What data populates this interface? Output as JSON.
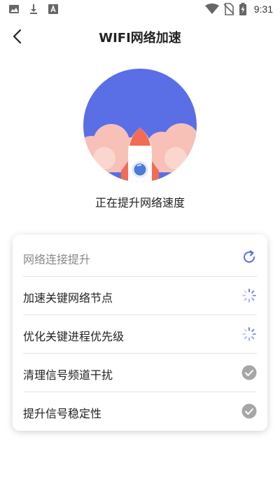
{
  "status_bar": {
    "time": "9:31",
    "left_icons": [
      "image-icon",
      "download-icon",
      "font-icon"
    ],
    "right_icons": [
      "wifi-icon",
      "no-sim-icon",
      "battery-charging-icon"
    ]
  },
  "header": {
    "title": "WIFI网络加速",
    "back_icon": "back-arrow-icon"
  },
  "hero": {
    "status_text": "正在提升网络速度",
    "colors": {
      "circle": "#5A6EE6",
      "cloud": "#F7C1B8",
      "rocket_nose": "#F26B54",
      "rocket_body": "#FFFFFF",
      "window": "#4A7BD8"
    }
  },
  "tasks": [
    {
      "label": "网络连接提升",
      "state": "refresh",
      "icon": "refresh-icon"
    },
    {
      "label": "加速关键网络节点",
      "state": "loading",
      "icon": "loading-spinner-icon"
    },
    {
      "label": "优化关键进程优先级",
      "state": "loading",
      "icon": "loading-spinner-icon"
    },
    {
      "label": "清理信号频道干扰",
      "state": "done",
      "icon": "check-circle-icon"
    },
    {
      "label": "提升信号稳定性",
      "state": "done",
      "icon": "check-circle-icon"
    }
  ],
  "colors": {
    "accent": "#5A6EE6",
    "done_gray": "#A6A6A6",
    "muted_text": "#888888"
  }
}
